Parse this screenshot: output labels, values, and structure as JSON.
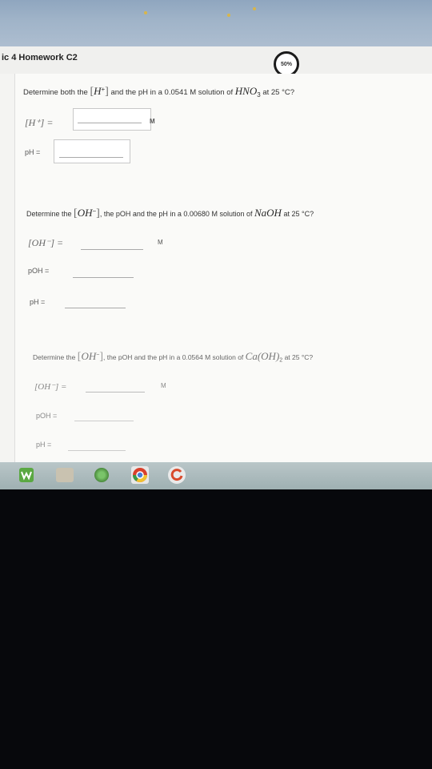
{
  "header": {
    "title": "ic 4 Homework C2",
    "progress": "50%"
  },
  "questions": [
    {
      "prefix": "Determine both the",
      "bracket_species": "H",
      "bracket_charge": "+",
      "middle": "and the pH in a 0.0541 M solution of",
      "formula": "HNO",
      "formula_sub": "3",
      "suffix": "at 25 °C?",
      "field1_label": "[H⁺] =",
      "field1_unit": "M",
      "field2_label": "pH ="
    },
    {
      "prefix": "Determine the",
      "bracket_species": "OH",
      "bracket_charge": "−",
      "middle": ", the pOH and the pH in a 0.00680 M solution of",
      "formula": "NaOH",
      "suffix": "at 25 °C?",
      "field1_label": "[OH⁻] =",
      "field1_unit": "M",
      "field2_label": "pOH =",
      "field3_label": "pH ="
    },
    {
      "prefix": "Determine the",
      "bracket_species": "OH",
      "bracket_charge": "−",
      "middle": ", the pOH and the pH in a 0.0564 M solution of",
      "formula": "Ca(OH)",
      "formula_sub": "2",
      "suffix": "at 25 °C?",
      "field1_label": "[OH⁻] =",
      "field1_unit": "M",
      "field2_label": "pOH =",
      "field3_label": "pH ="
    }
  ],
  "taskbar": {
    "items": [
      "w-icon",
      "app-icon",
      "settings-icon",
      "chrome-icon",
      "refresh-icon"
    ]
  }
}
